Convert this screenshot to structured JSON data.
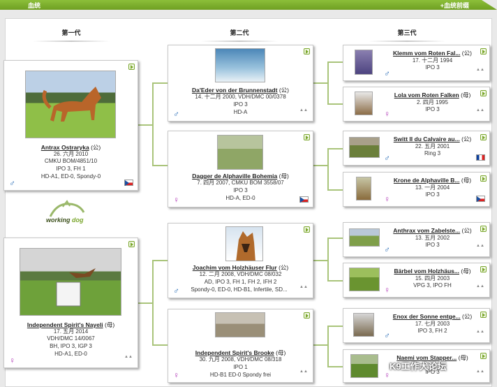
{
  "header": {
    "title": "血统",
    "action": "+血统前缀"
  },
  "generations": [
    "第一代",
    "第二代",
    "第三代"
  ],
  "logo": {
    "text_main": "working",
    "text_accent": "dog"
  },
  "watermark": "K9工作犬论坛",
  "gen1": [
    {
      "name": "Antrax Ostraryka",
      "sex_label": "(公)",
      "sex": "male",
      "lines": [
        "26. 六月 2010",
        "CMKU BOM/4851/10",
        "IPO 3, FH 1",
        "HD-A1, ED-0, Spondy-0"
      ],
      "flag": "cz"
    },
    {
      "name": "Independent Spirit's Nayeli",
      "sex_label": "(母)",
      "sex": "female",
      "lines": [
        "17. 五月 2014",
        "VDH/DMC 14/0067",
        "BH, IPO 3, IGP 3",
        "HD-A1, ED-0"
      ],
      "flag": "pdf"
    }
  ],
  "gen2": [
    {
      "name": "Da'Eder von der Brunnenstadt",
      "sex_label": "(公)",
      "sex": "male",
      "lines": [
        "14. 十二月 2000, VDH/DMC 00/0378",
        "IPO 3",
        "HD-A"
      ],
      "flag": "pdf"
    },
    {
      "name": "Dagger de Alphaville Bohemia",
      "sex_label": "(母)",
      "sex": "female",
      "lines": [
        "7. 四月 2007, CMKU BOM 3558/07",
        "IPO 3",
        "HD-A, ED-0"
      ],
      "flag": "cz"
    },
    {
      "name": "Joachim vom Holzhäuser Flur",
      "sex_label": "(公)",
      "sex": "male",
      "lines": [
        "12. 二月 2008, VDH/DMC 08/032",
        "AD, IPO 3, FH 1, FH 2, IFH 2",
        "Spondy-0, ED-0, HD-B1, Infertile, SD..."
      ],
      "flag": "pdf"
    },
    {
      "name": "Independent Spirit's Brooke",
      "sex_label": "(母)",
      "sex": "female",
      "lines": [
        "30. 九月 2008, VDH/DMC 08/318",
        "IPO 1",
        "HD-B1 ED-0 Spondy frei"
      ],
      "flag": "pdf"
    }
  ],
  "gen3": [
    {
      "name": "Klemm vom Roten Fal...",
      "sex_label": "(公)",
      "sex": "male",
      "lines": [
        "17. 十二月 1994",
        "IPO 3"
      ],
      "flag": "pdf"
    },
    {
      "name": "Lola vom Roten Falken",
      "sex_label": "(母)",
      "sex": "female",
      "lines": [
        "2. 四月 1995",
        "IPO 3"
      ],
      "flag": "pdf"
    },
    {
      "name": "Switt II du Calvaire au...",
      "sex_label": "(公)",
      "sex": "male",
      "lines": [
        "22. 五月 2001",
        "Ring 3"
      ],
      "flag": "fr"
    },
    {
      "name": "Krone de Alphaville B...",
      "sex_label": "(母)",
      "sex": "female",
      "lines": [
        "13. 一月 2004",
        "IPO 3"
      ],
      "flag": "cz"
    },
    {
      "name": "Anthrax vom Zabelste...",
      "sex_label": "(公)",
      "sex": "male",
      "lines": [
        "13. 五月 2002",
        "IPO 3"
      ],
      "flag": "pdf"
    },
    {
      "name": "Bärbel vom Holzhäus...",
      "sex_label": "(母)",
      "sex": "female",
      "lines": [
        "15. 四月 2003",
        "VPG 3, IPO FH"
      ],
      "flag": "pdf"
    },
    {
      "name": "Enox der Sonne entge...",
      "sex_label": "(公)",
      "sex": "male",
      "lines": [
        "17. 七月 2003",
        "IPO 3, FH 2"
      ],
      "flag": "pdf"
    },
    {
      "name": "Naemi vom Stapper...",
      "sex_label": "(母)",
      "sex": "female",
      "lines": [
        "",
        "IPO 3"
      ],
      "flag": "pdf"
    }
  ],
  "colors": {
    "accent": "#7aa62c",
    "male": "#2d6fb8",
    "female": "#b23ab7",
    "line": "#a9c47a"
  }
}
